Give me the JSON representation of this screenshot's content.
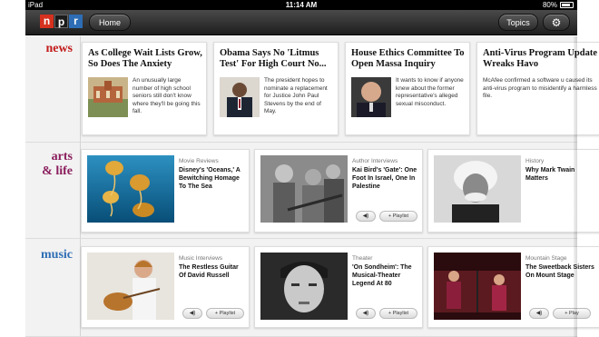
{
  "status_bar": {
    "carrier": "iPad",
    "time": "11:14 AM",
    "battery": "80%"
  },
  "nav": {
    "logo": [
      "n",
      "p",
      "r"
    ],
    "home_label": "Home",
    "topics_label": "Topics",
    "settings_icon": "gear-icon"
  },
  "sections": {
    "news": {
      "label": "news",
      "stories": [
        {
          "headline": "As College Wait Lists Grow, So Does The Anxiety",
          "teaser": "An unusually large number of high school seniors still don't know where they'll be going this fall."
        },
        {
          "headline": "Obama Says No 'Litmus Test' For High Court No...",
          "teaser": "The president hopes to nominate a replacement for Justice John Paul Stevens by the end of May."
        },
        {
          "headline": "House Ethics Committee To Open Massa Inquiry",
          "teaser": "It wants to know if anyone knew about the former representative's alleged sexual misconduct."
        },
        {
          "headline": "Anti-Virus Program Update Wreaks Havo",
          "teaser": "McAfee confirmed a software u caused its anti-virus program to misidentify a harmless file."
        }
      ]
    },
    "arts": {
      "label_line1": "arts",
      "label_line2": "& life",
      "stories": [
        {
          "category": "Movie Reviews",
          "title": "Disney's 'Oceans,' A Bewitching Homage To The Sea"
        },
        {
          "category": "Author Interviews",
          "title": "Kai Bird's 'Gate': One Foot In Israel, One In Palestine",
          "listen": "◀)",
          "playlist": "+ Playlist"
        },
        {
          "category": "History",
          "title": "Why Mark Twain Matters"
        }
      ]
    },
    "music": {
      "label": "music",
      "stories": [
        {
          "category": "Music Interviews",
          "title": "The Restless Guitar Of David Russell",
          "listen": "◀)",
          "playlist": "+ Playlist"
        },
        {
          "category": "Theater",
          "title": "'On Sondheim': The Musical-Theater Legend At 80",
          "listen": "◀)",
          "playlist": "+ Playlist"
        },
        {
          "category": "Mountain Stage",
          "title": "The Sweetback Sisters On Mount Stage",
          "listen": "◀)",
          "playlist": "+ Play"
        }
      ]
    }
  },
  "colors": {
    "news": "#c21a1a",
    "arts": "#8a1e5c",
    "music": "#2d6db5",
    "npr_red": "#d6311f",
    "npr_blue": "#2d6db5"
  }
}
